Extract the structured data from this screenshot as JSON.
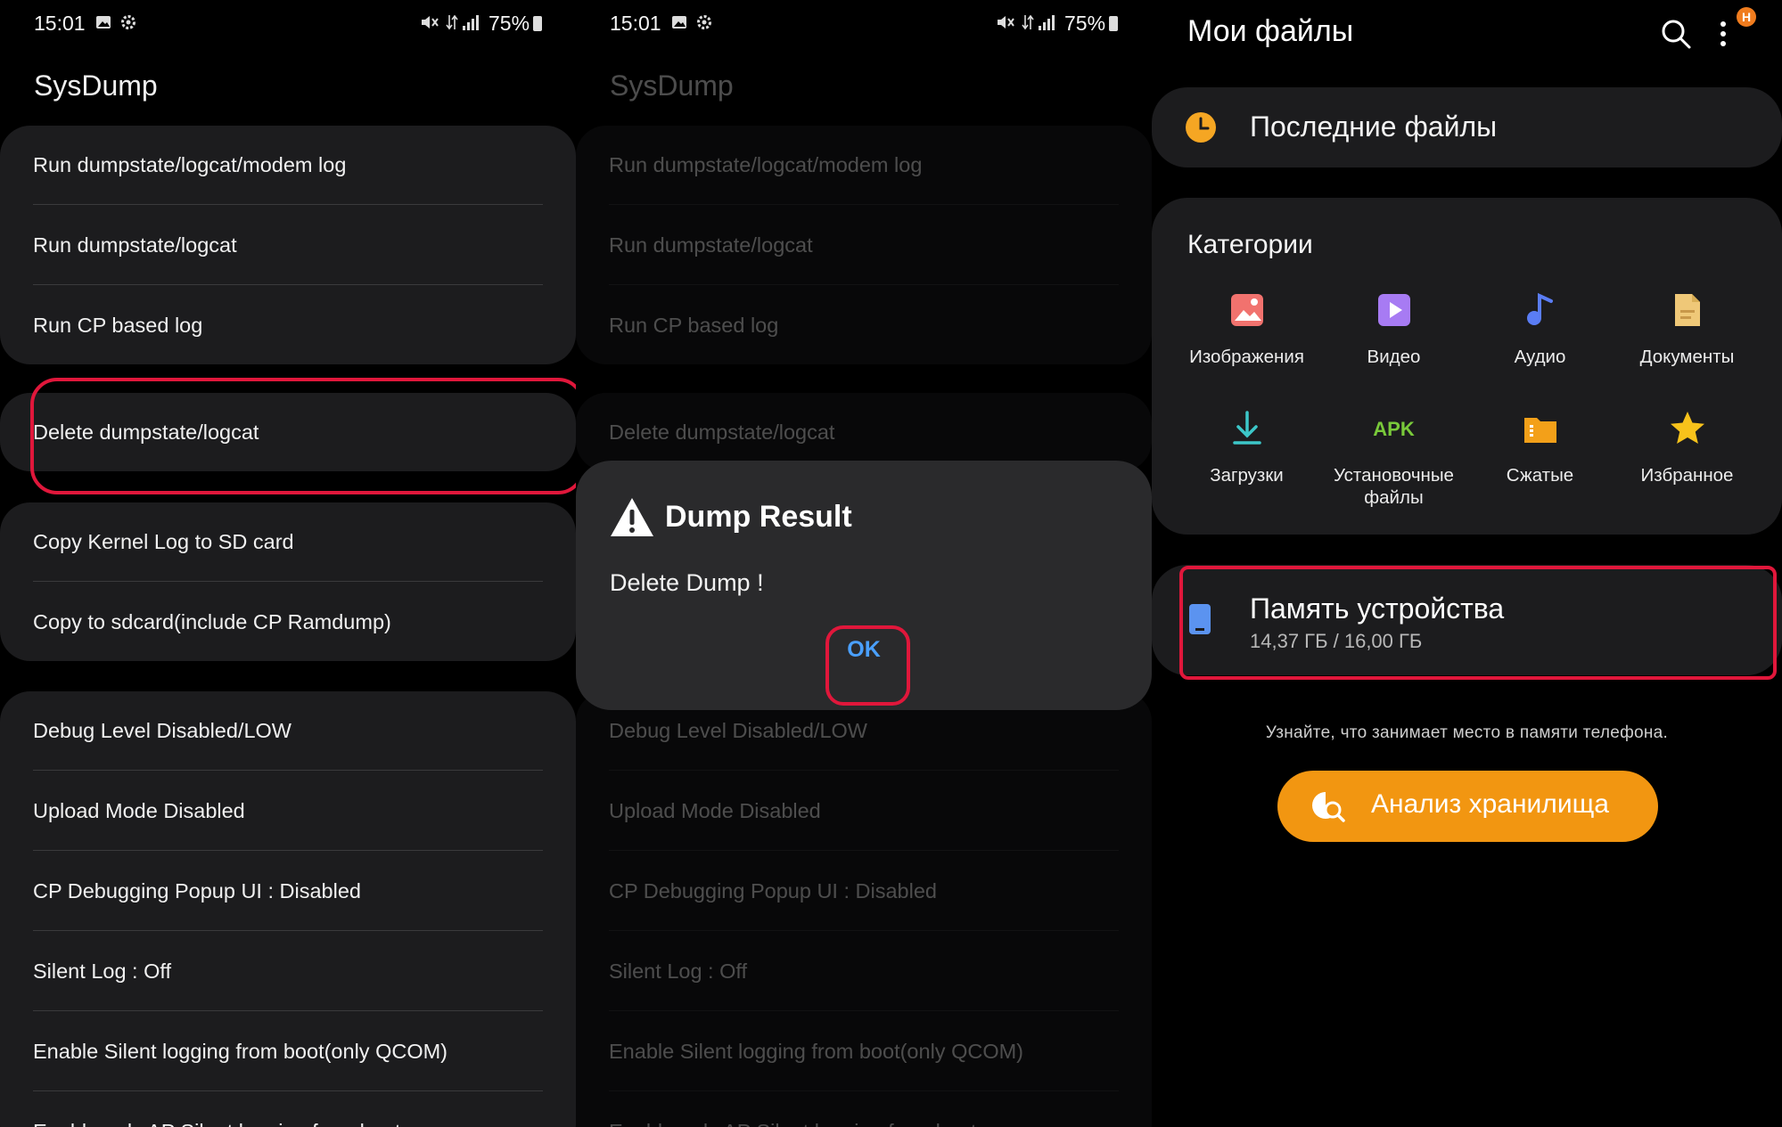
{
  "status_bar": {
    "time": "15:01",
    "battery": "75%"
  },
  "sysdump": {
    "title": "SysDump",
    "group1": [
      "Run dumpstate/logcat/modem log",
      "Run dumpstate/logcat",
      "Run CP based log"
    ],
    "group2": [
      "Delete dumpstate/logcat"
    ],
    "group3": [
      "Copy Kernel Log to SD card",
      "Copy to sdcard(include CP Ramdump)"
    ],
    "group4": [
      "Debug Level Disabled/LOW",
      "Upload Mode Disabled",
      "CP Debugging Popup UI : Disabled",
      "Silent Log : Off",
      "Enable Silent logging from boot(only QCOM)",
      "Enable only AP Silent logging from boot"
    ]
  },
  "dialog": {
    "title": "Dump Result",
    "message": "Delete Dump !",
    "ok_label": "OK"
  },
  "my_files": {
    "title": "Мои файлы",
    "badge": "H",
    "recent_label": "Последние файлы",
    "categories_title": "Категории",
    "categories": [
      {
        "label": "Изображения",
        "icon": "images-icon"
      },
      {
        "label": "Видео",
        "icon": "video-icon"
      },
      {
        "label": "Аудио",
        "icon": "audio-icon"
      },
      {
        "label": "Документы",
        "icon": "documents-icon"
      },
      {
        "label": "Загрузки",
        "icon": "downloads-icon"
      },
      {
        "label": "Установочные файлы",
        "icon": "apk-icon",
        "icon_text": "APK"
      },
      {
        "label": "Сжатые",
        "icon": "compressed-icon"
      },
      {
        "label": "Избранное",
        "icon": "favorites-star-icon"
      }
    ],
    "storage_title": "Память устройства",
    "storage_usage": "14,37 ГБ / 16,00 ГБ",
    "hint": "Узнайте, что занимает место в памяти телефона.",
    "analyze_label": "Анализ хранилища"
  },
  "colors": {
    "highlight": "#e0173b",
    "accent_orange": "#f29611",
    "ok_blue": "#4aa0ff",
    "card": "#1c1c1e"
  }
}
